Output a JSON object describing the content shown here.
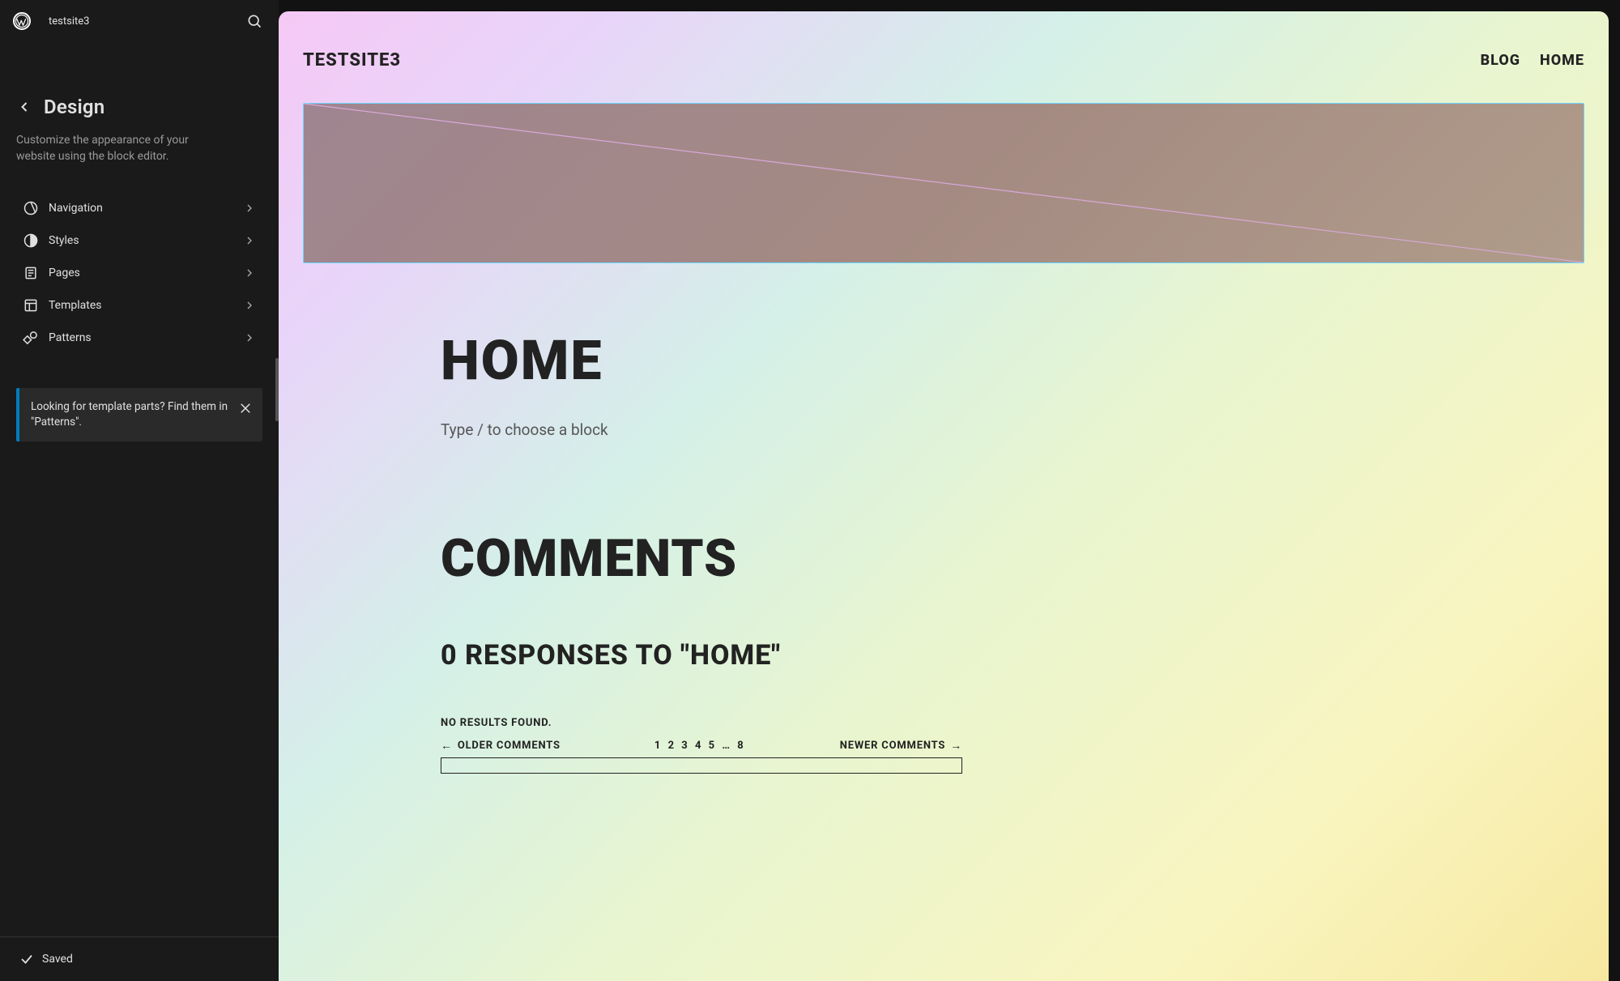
{
  "top_bar": {
    "site_name": "testsite3"
  },
  "sidebar": {
    "title": "Design",
    "description": "Customize the appearance of your website using the block editor.",
    "items": [
      {
        "icon": "navigation-icon",
        "label": "Navigation"
      },
      {
        "icon": "styles-icon",
        "label": "Styles"
      },
      {
        "icon": "pages-icon",
        "label": "Pages"
      },
      {
        "icon": "templates-icon",
        "label": "Templates"
      },
      {
        "icon": "patterns-icon",
        "label": "Patterns"
      }
    ],
    "notice": {
      "text": "Looking for template parts? Find them in \"Patterns\".",
      "accent_color": "#007cba"
    },
    "footer": {
      "saved_label": "Saved"
    }
  },
  "editor": {
    "brand": "TESTSITE3",
    "nav": [
      {
        "label": "BLOG"
      },
      {
        "label": "HOME"
      }
    ],
    "home_heading": "HOME",
    "block_placeholder": "Type / to choose a block",
    "comments_heading": "COMMENTS",
    "responses_heading": "0 RESPONSES TO \"HOME\"",
    "no_results": "NO RESULTS FOUND.",
    "comments_nav": {
      "older_label": "OLDER COMMENTS",
      "pages_string": "1 2 3 4 5 … 8",
      "newer_label": "NEWER COMMENTS"
    }
  }
}
